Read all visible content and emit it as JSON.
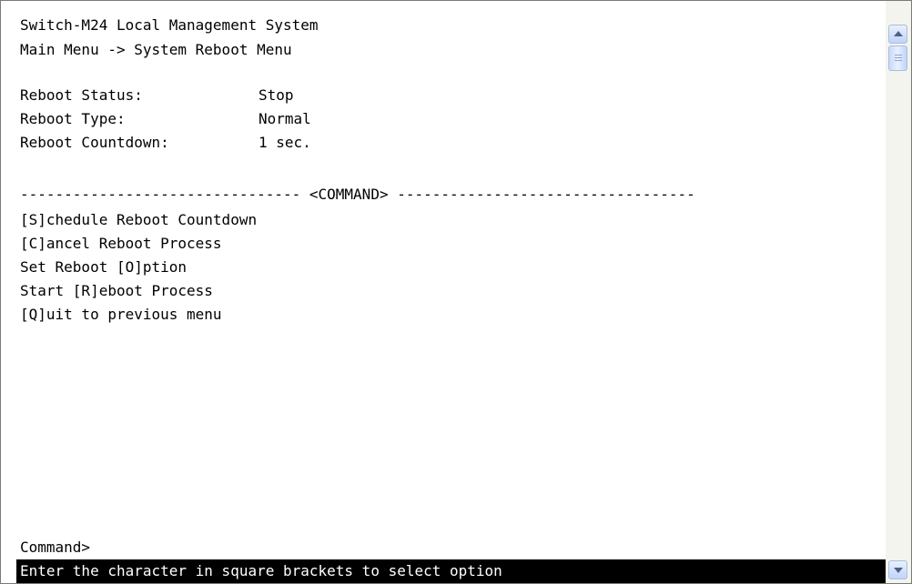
{
  "header": {
    "title": "Switch-M24 Local Management System",
    "breadcrumb": "Main Menu -> System Reboot Menu"
  },
  "reboot_info": [
    {
      "label": "Reboot Status:",
      "value": "Stop"
    },
    {
      "label": "Reboot Type:",
      "value": "Normal"
    },
    {
      "label": "Reboot Countdown:",
      "value": "1 sec."
    }
  ],
  "command_divider": "-------------------------------- <COMMAND> ----------------------------------",
  "commands": [
    "[S]chedule Reboot Countdown",
    "[C]ancel Reboot Process",
    "Set Reboot [O]ption",
    "Start [R]eboot Process",
    "[Q]uit to previous menu"
  ],
  "prompt": "Command>",
  "status_bar": "Enter the character in square brackets to select option",
  "scrollbar": {
    "position": 0.0
  }
}
